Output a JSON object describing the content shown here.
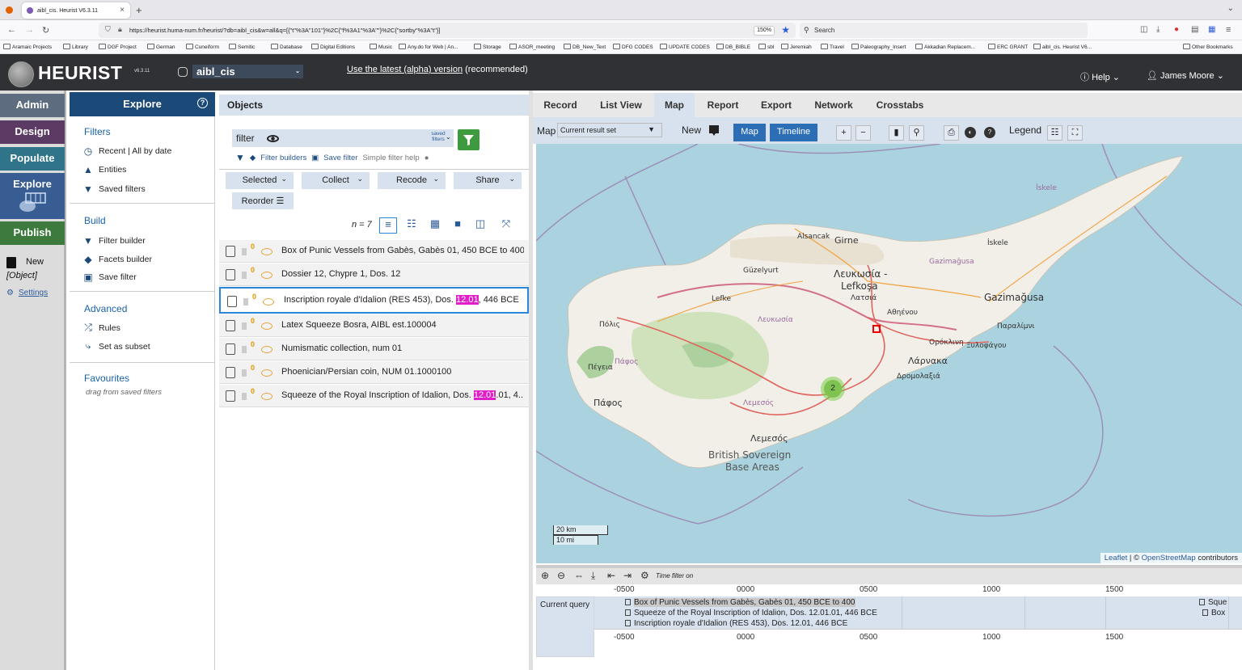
{
  "browser": {
    "tab_title": "aibl_cis. Heurist V6.3.11",
    "url": "https://heurist.huma-num.fr/heurist/?db=aibl_cis&w=all&q=[{\"t\"%3A\"101\"}%2C{\"f%3A1\"%3A\"\"}%2C{\"sortby\"%3A\"t\"}]",
    "zoom": "150%",
    "search_placeholder": "Search",
    "bookmarks": [
      "Aramaic Projects",
      "Library",
      "DGF Project",
      "German",
      "Cuneiform",
      "Semitic",
      "Database",
      "Digital Editions",
      "Music",
      "Any.do for Web | An...",
      "Storage",
      "ASOR_meeting",
      "DB_New_Text",
      "DFG CODES",
      "UPDATE CODES",
      "DB_BIBLE",
      "sbl",
      "Jeremiah",
      "Travel",
      "Paleography_Insert",
      "Akkadian Replacem...",
      "ERC GRANT",
      "aibl_cis. Heurist V6..."
    ],
    "other_bookmarks": "Other Bookmarks"
  },
  "header": {
    "logo": "HEURIST",
    "version": "v6.3.11",
    "db_name": "aibl_cis",
    "alpha_link": "Use the latest (alpha) version",
    "alpha_note": " (recommended)",
    "help": "Help",
    "user": "James Moore"
  },
  "leftnav": {
    "admin": "Admin",
    "design": "Design",
    "populate": "Populate",
    "explore": "Explore",
    "publish": "Publish",
    "new": "New",
    "new_type": "[Object]",
    "settings": "Settings"
  },
  "explore": {
    "title": "Explore",
    "filters_heading": "Filters",
    "recent": "Recent | All by date",
    "entities": "Entities",
    "saved_filters": "Saved filters",
    "build_heading": "Build",
    "filter_builder": "Filter builder",
    "facets_builder": "Facets builder",
    "save_filter": "Save filter",
    "advanced_heading": "Advanced",
    "rules": "Rules",
    "set_subset": "Set as subset",
    "favourites_heading": "Favourites",
    "favourites_hint": "drag from saved filters"
  },
  "objects": {
    "title": "Objects",
    "filter_value": "filter",
    "saved_filters_btn": "saved filters",
    "filter_builders": "Filter builders",
    "save_filter": "Save filter",
    "simple_help": "Simple filter help",
    "actions": [
      "Selected",
      "Collect",
      "Recode",
      "Share"
    ],
    "reorder": "Reorder",
    "count": "n = 7",
    "records": [
      {
        "pre": "Box of Punic Vessels from Gabès, Gabès 01, 450 BCE to 400",
        "hl": "",
        "post": ""
      },
      {
        "pre": "Dossier 12, Chypre 1, Dos. 12",
        "hl": "",
        "post": ""
      },
      {
        "pre": "Inscription royale d'Idalion (RES 453), Dos. ",
        "hl": "12.01",
        "post": ", 446 BCE"
      },
      {
        "pre": "Latex Squeeze Bosra, AIBL est.100004",
        "hl": "",
        "post": ""
      },
      {
        "pre": "Numismatic collection, num 01",
        "hl": "",
        "post": ""
      },
      {
        "pre": "Phoenician/Persian coin, NUM 01.1000100",
        "hl": "",
        "post": ""
      },
      {
        "pre": "Squeeze of the Royal Inscription of Idalion, Dos. ",
        "hl": "12.01",
        "post": ".01, 4..."
      }
    ]
  },
  "rightpane": {
    "tabs": [
      "Record",
      "List View",
      "Map",
      "Report",
      "Export",
      "Network",
      "Crosstabs"
    ],
    "active_tab": "Map",
    "map_label": "Map",
    "map_source": "Current result set",
    "new_label": "New",
    "map_btn": "Map",
    "timeline_btn": "Timeline",
    "legend": "Legend",
    "map_labels": [
      "Girne",
      "Alsancak",
      "Güzelyurt",
      "Λευκωσία -",
      "Lefkoşa",
      "Λατσιά",
      "Gazimağusa",
      "Gazimağusa",
      "İskele",
      "İskele",
      "Lefke",
      "Πόλις",
      "Πέγεια",
      "Πάφος",
      "Πάφος",
      "Λευκωσία",
      "Αθηένου",
      "Ορόκλινη",
      "Ξυλοφάγου",
      "Παραλίμνι",
      "Λάρνακα",
      "Δρομολαξιά",
      "Λεμεσός",
      "Λεμεσός",
      "British Sovereign",
      "Base Areas"
    ],
    "cluster_count": "2",
    "scale_km": "20 km",
    "scale_mi": "10 mi",
    "attribution_leaflet": "Leaflet",
    "attribution_sep": " | © ",
    "attribution_osm": "OpenStreetMap",
    "attribution_rest": " contributors"
  },
  "timeline": {
    "filter_text": "Time filter on",
    "ticks": [
      "-0500",
      "0000",
      "0500",
      "1000",
      "1500"
    ],
    "group": "Current query",
    "items": [
      "Box of Punic Vessels from Gabès, Gabès 01, 450 BCE to 400",
      "Squeeze of the Royal Inscription of Idalion, Dos. 12.01.01, 446 BCE",
      "Inscription royale d'Idalion (RES 453), Dos. 12.01, 446 BCE"
    ],
    "edge_items": [
      "Sque",
      "Box"
    ]
  },
  "colors": {
    "header": "#303134",
    "explore_head": "#1b4a79",
    "sea": "#aad3df",
    "land": "#f2efe9",
    "accent": "#2c6eb6"
  }
}
